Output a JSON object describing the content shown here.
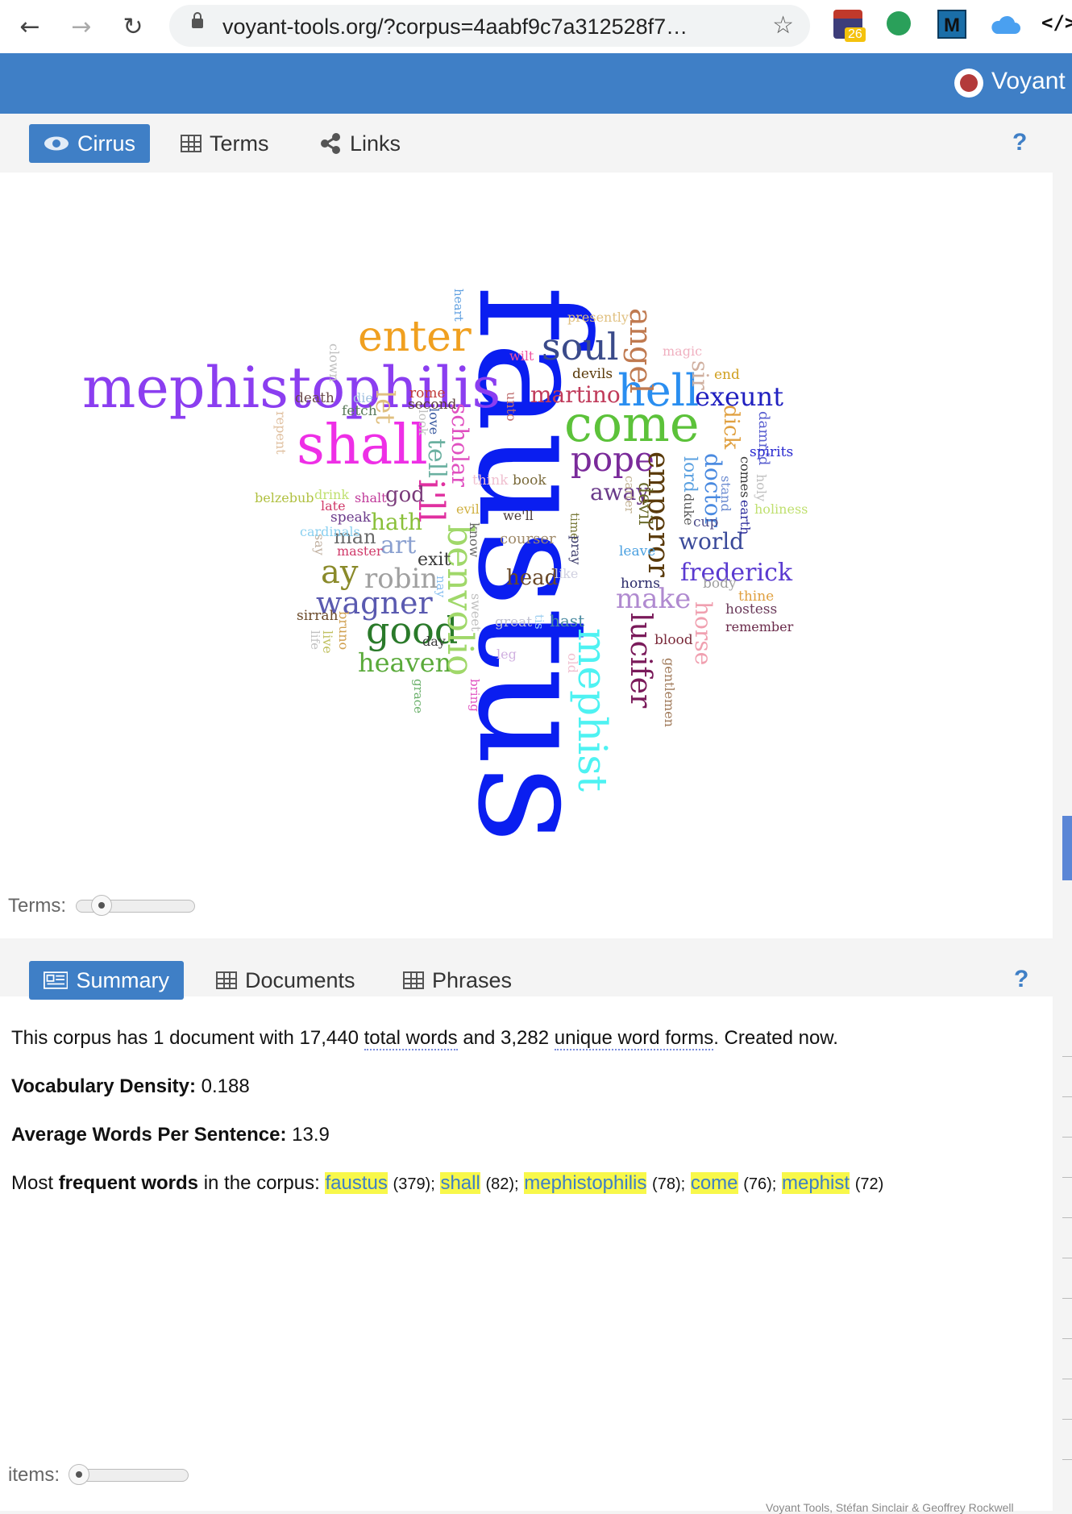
{
  "browser": {
    "url": "voyant-tools.org/?corpus=4aabf9c7a312528f7…",
    "back_icon": "←",
    "forward_icon": "→",
    "reload_icon": "↻",
    "star_icon": "☆",
    "ext_badge": "26",
    "ext_m_label": "M",
    "ext_code_label": "</>"
  },
  "header": {
    "title": "Voyant"
  },
  "cirrus_panel": {
    "tabs": [
      {
        "label": "Cirrus",
        "active": true
      },
      {
        "label": "Terms",
        "active": false
      },
      {
        "label": "Links",
        "active": false
      }
    ],
    "help": "?",
    "slider_label": "Terms:",
    "words": [
      {
        "text": "faustus",
        "color": "#0a1ef0"
      },
      {
        "text": "mephistophilis",
        "color": "#8b3ef0"
      },
      {
        "text": "shall",
        "color": "#ee2fe6"
      },
      {
        "text": "come",
        "color": "#5cc23a"
      },
      {
        "text": "mephist",
        "color": "#4ef2f2"
      },
      {
        "text": "enter",
        "color": "#f0a020"
      },
      {
        "text": "soul",
        "color": "#3a4a8a"
      },
      {
        "text": "hell",
        "color": "#2a8ef0"
      },
      {
        "text": "exeunt",
        "color": "#2020c0"
      },
      {
        "text": "pope",
        "color": "#7a2a9a"
      },
      {
        "text": "angel",
        "color": "#c07a50"
      },
      {
        "text": "good",
        "color": "#2a7a2a"
      },
      {
        "text": "heaven",
        "color": "#5aaa3a"
      },
      {
        "text": "wagner",
        "color": "#5a5ab0"
      },
      {
        "text": "benvolio",
        "color": "#a0d86a"
      },
      {
        "text": "emperor",
        "color": "#5a3a0a"
      },
      {
        "text": "lucifer",
        "color": "#7a1a5a"
      },
      {
        "text": "horse",
        "color": "#f0a0b0"
      },
      {
        "text": "make",
        "color": "#b08ad0"
      },
      {
        "text": "frederick",
        "color": "#5a3ad0"
      },
      {
        "text": "world",
        "color": "#3a4a9a"
      },
      {
        "text": "doctor",
        "color": "#4a8ae0"
      },
      {
        "text": "lord",
        "color": "#5aa0e0"
      },
      {
        "text": "dick",
        "color": "#e0a040"
      },
      {
        "text": "martino",
        "color": "#c03a5a"
      },
      {
        "text": "scholar",
        "color": "#e050c0"
      },
      {
        "text": "tell",
        "color": "#6ab0a0"
      },
      {
        "text": "i'll",
        "color": "#e030a0"
      },
      {
        "text": "ay",
        "color": "#8a8a2a"
      },
      {
        "text": "robin",
        "color": "#a0a0a0"
      },
      {
        "text": "art",
        "color": "#8aa0d0"
      },
      {
        "text": "hath",
        "color": "#8ac03a"
      },
      {
        "text": "man",
        "color": "#6a6a6a"
      },
      {
        "text": "god",
        "color": "#7a3a7a"
      },
      {
        "text": "let",
        "color": "#e0c080"
      },
      {
        "text": "away",
        "color": "#6a3a8a"
      },
      {
        "text": "head",
        "color": "#6a4a2a"
      },
      {
        "text": "exit",
        "color": "#3a3a3a"
      },
      {
        "text": "devil",
        "color": "#6a6a2a"
      },
      {
        "text": "sir",
        "color": "#d0b0a0"
      },
      {
        "text": "presently",
        "color": "#e0c080"
      },
      {
        "text": "magic",
        "color": "#f0b0c0"
      },
      {
        "text": "wilt",
        "color": "#f050a0"
      },
      {
        "text": "devils",
        "color": "#5a3a0a"
      },
      {
        "text": "end",
        "color": "#d0a020"
      },
      {
        "text": "damn'd",
        "color": "#5a60d0"
      },
      {
        "text": "spirits",
        "color": "#2a2ad0"
      },
      {
        "text": "comes",
        "color": "#3a3a3a"
      },
      {
        "text": "holy",
        "color": "#c0c0c0"
      },
      {
        "text": "stand",
        "color": "#6a8ad0"
      },
      {
        "text": "earth",
        "color": "#2a2a9a"
      },
      {
        "text": "holiness",
        "color": "#c0e070"
      },
      {
        "text": "duke",
        "color": "#5a5a5a"
      },
      {
        "text": "cup",
        "color": "#4a4a8a"
      },
      {
        "text": "carter",
        "color": "#c0b090"
      },
      {
        "text": "leave",
        "color": "#4aa0e0"
      },
      {
        "text": "body",
        "color": "#a0a0a0"
      },
      {
        "text": "thine",
        "color": "#e0a040"
      },
      {
        "text": "hostess",
        "color": "#6a3a5a"
      },
      {
        "text": "remember",
        "color": "#6a2a4a"
      },
      {
        "text": "horns",
        "color": "#2a2a6a"
      },
      {
        "text": "blood",
        "color": "#7a2a3a"
      },
      {
        "text": "gentlemen",
        "color": "#a07a5a"
      },
      {
        "text": "old",
        "color": "#f0c0d0"
      },
      {
        "text": "hast",
        "color": "#4a8aa0"
      },
      {
        "text": "tis",
        "color": "#a0d0f0"
      },
      {
        "text": "great",
        "color": "#c0c0d0"
      },
      {
        "text": "leg",
        "color": "#d0b0e0"
      },
      {
        "text": "like",
        "color": "#d0d0e0"
      },
      {
        "text": "courser",
        "color": "#a08a6a"
      },
      {
        "text": "we'll",
        "color": "#4a3a3a"
      },
      {
        "text": "time",
        "color": "#7a7a3a"
      },
      {
        "text": "pray",
        "color": "#3a3a6a"
      },
      {
        "text": "book",
        "color": "#7a6a3a"
      },
      {
        "text": "think",
        "color": "#f0c0d0"
      },
      {
        "text": "evil",
        "color": "#d0b040"
      },
      {
        "text": "know",
        "color": "#6a6a6a"
      },
      {
        "text": "sweet",
        "color": "#c0c0c0"
      },
      {
        "text": "nay",
        "color": "#8ac0f0"
      },
      {
        "text": "bring",
        "color": "#e050c0"
      },
      {
        "text": "day",
        "color": "#3a3a3a"
      },
      {
        "text": "grace",
        "color": "#6ab06a"
      },
      {
        "text": "bruno",
        "color": "#d0a050"
      },
      {
        "text": "live",
        "color": "#c0c060"
      },
      {
        "text": "life",
        "color": "#c0c0c0"
      },
      {
        "text": "sirrah",
        "color": "#6a4a2a"
      },
      {
        "text": "master",
        "color": "#d03a6a"
      },
      {
        "text": "say",
        "color": "#c0b0a0"
      },
      {
        "text": "cardinals",
        "color": "#8ad0f0"
      },
      {
        "text": "speak",
        "color": "#6a3a8a"
      },
      {
        "text": "late",
        "color": "#d03a6a"
      },
      {
        "text": "drink",
        "color": "#c0e070"
      },
      {
        "text": "shalt",
        "color": "#c03a9a"
      },
      {
        "text": "belzebub",
        "color": "#b0c040"
      },
      {
        "text": "repent",
        "color": "#e0c0a0"
      },
      {
        "text": "death",
        "color": "#6a4a4a"
      },
      {
        "text": "die",
        "color": "#a0c0e0"
      },
      {
        "text": "fetch",
        "color": "#5a7a5a"
      },
      {
        "text": "rome",
        "color": "#c03a3a"
      },
      {
        "text": "second",
        "color": "#5a3a3a"
      },
      {
        "text": "love",
        "color": "#3a5aa0"
      },
      {
        "text": "look",
        "color": "#c0c0c0"
      },
      {
        "text": "clown",
        "color": "#c0c0c0"
      },
      {
        "text": "heart",
        "color": "#60a0e0"
      },
      {
        "text": "unto",
        "color": "#c07070"
      }
    ]
  },
  "summary_panel": {
    "tabs": [
      {
        "label": "Summary",
        "active": true
      },
      {
        "label": "Documents",
        "active": false
      },
      {
        "label": "Phrases",
        "active": false
      }
    ],
    "help": "?",
    "line1_prefix": "This corpus has 1 document with 17,440",
    "line1_total": "total words",
    "line1_and": "and 3,282",
    "line1_unique": "unique word forms",
    "line1_suffix": ". Created now.",
    "vocab_label": "Vocabulary Density:",
    "vocab_value": "0.188",
    "avg_label": "Average Words Per Sentence:",
    "avg_value": "13.9",
    "most_prefix": "Most",
    "most_bold": "frequent words",
    "most_suffix": "in the corpus:",
    "frequent_words": [
      {
        "word": "faustus",
        "count": "(379);"
      },
      {
        "word": "shall",
        "count": "(82);"
      },
      {
        "word": "mephistophilis",
        "count": "(78);"
      },
      {
        "word": "come",
        "count": "(76);"
      },
      {
        "word": "mephist",
        "count": "(72)"
      }
    ],
    "slider_label": "items:"
  },
  "footer": {
    "text": "Voyant Tools, Stéfan Sinclair & Geoffrey Rockwell"
  }
}
